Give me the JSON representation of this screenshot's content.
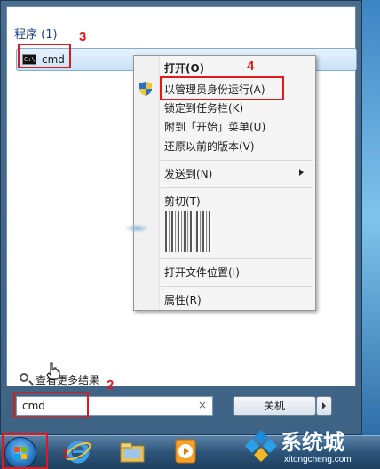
{
  "start_menu": {
    "section_header": "程序 (1)",
    "program": {
      "label": "cmd",
      "icon": "cmd-console-icon"
    },
    "see_more_text": "查看更多结果",
    "search": {
      "value": "cmd",
      "clear": "×"
    },
    "shutdown_label": "关机"
  },
  "context_menu": {
    "items": [
      {
        "label": "打开(O)",
        "bold": true
      },
      {
        "label": "以管理员身份运行(A)",
        "icon": "shield-icon"
      },
      {
        "label": "锁定到任务栏(K)"
      },
      {
        "label": "附到「开始」菜单(U)"
      },
      {
        "label": "还原以前的版本(V)"
      },
      {
        "label": "发送到(N)",
        "submenu": true
      },
      {
        "label": "剪切(T)"
      },
      {
        "label": "打开文件位置(I)"
      },
      {
        "label": "属性(R)"
      }
    ]
  },
  "annotations": {
    "num1": "1",
    "num2": "2",
    "num3": "3",
    "num4": "4",
    "color": "#e0191b"
  },
  "taskbar": {
    "icons": [
      "start-orb",
      "internet-explorer-icon",
      "windows-explorer-icon",
      "media-player-icon"
    ]
  },
  "watermark": {
    "title": "系统城",
    "url": "xitongcheng.com"
  }
}
